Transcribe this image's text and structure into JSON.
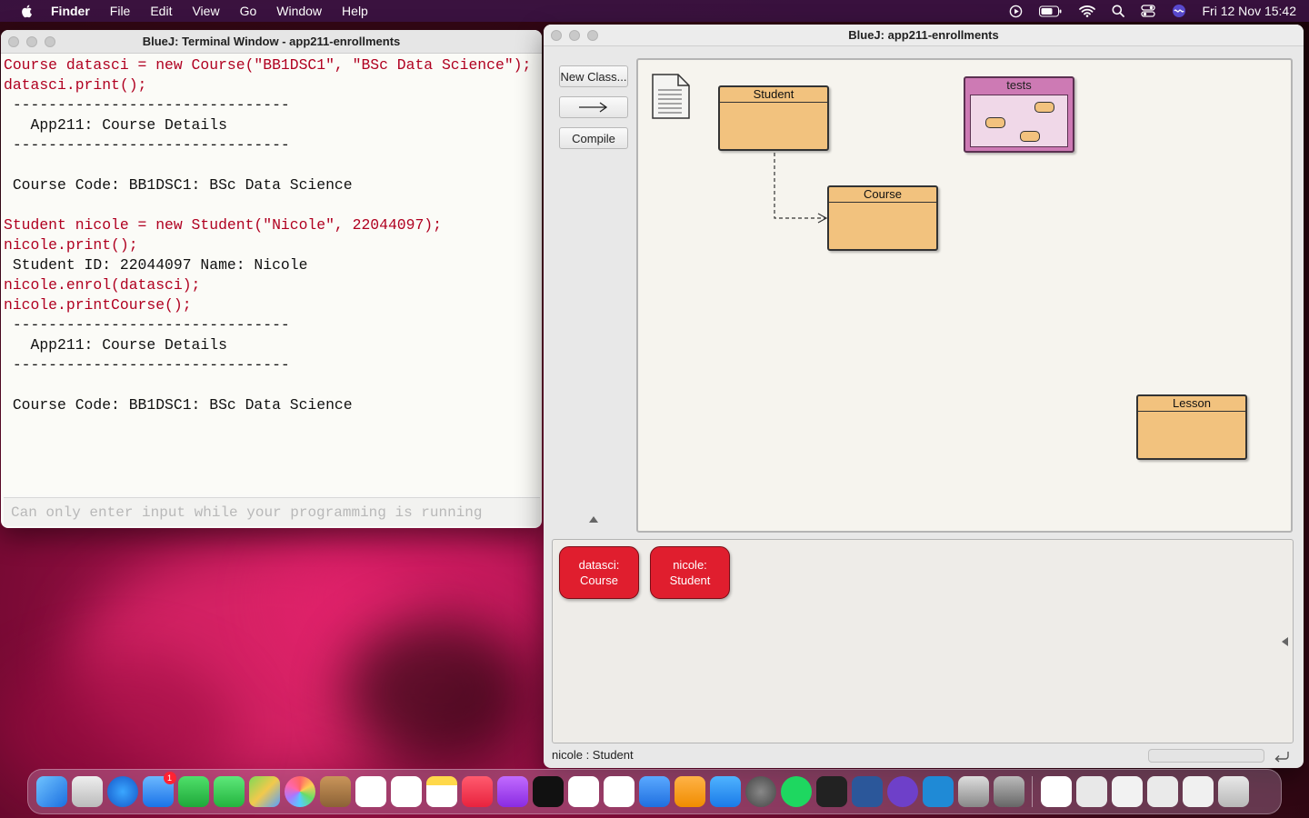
{
  "menubar": {
    "app": "Finder",
    "items": [
      "File",
      "Edit",
      "View",
      "Go",
      "Window",
      "Help"
    ],
    "clock": "Fri 12 Nov  15:42"
  },
  "terminal": {
    "title": "BlueJ: Terminal Window - app211-enrollments",
    "lines": [
      {
        "text": "Course datasci = new Course(\"BB1DSC1\", \"BSc Data Science\");",
        "red": true
      },
      {
        "text": "datasci.print();",
        "red": true
      },
      {
        "text": " -------------------------------",
        "red": false
      },
      {
        "text": "   App211: Course Details",
        "red": false
      },
      {
        "text": " -------------------------------",
        "red": false
      },
      {
        "text": "",
        "red": false
      },
      {
        "text": " Course Code: BB1DSC1: BSc Data Science",
        "red": false
      },
      {
        "text": "",
        "red": false
      },
      {
        "text": "Student nicole = new Student(\"Nicole\", 22044097);",
        "red": true
      },
      {
        "text": "nicole.print();",
        "red": true
      },
      {
        "text": " Student ID: 22044097 Name: Nicole",
        "red": false
      },
      {
        "text": "nicole.enrol(datasci);",
        "red": true
      },
      {
        "text": "nicole.printCourse();",
        "red": true
      },
      {
        "text": " -------------------------------",
        "red": false
      },
      {
        "text": "   App211: Course Details",
        "red": false
      },
      {
        "text": " -------------------------------",
        "red": false
      },
      {
        "text": "",
        "red": false
      },
      {
        "text": " Course Code: BB1DSC1: BSc Data Science",
        "red": false
      }
    ],
    "input_placeholder": "Can only enter input while your programming is running"
  },
  "main": {
    "title": "BlueJ:  app211-enrollments",
    "buttons": {
      "new_class": "New Class...",
      "compile": "Compile"
    },
    "classes": {
      "student": "Student",
      "course": "Course",
      "lesson": "Lesson",
      "tests": "tests"
    },
    "objects": [
      {
        "line1": "datasci:",
        "line2": "Course"
      },
      {
        "line1": "nicole:",
        "line2": "Student"
      }
    ],
    "status": "nicole : Student"
  }
}
